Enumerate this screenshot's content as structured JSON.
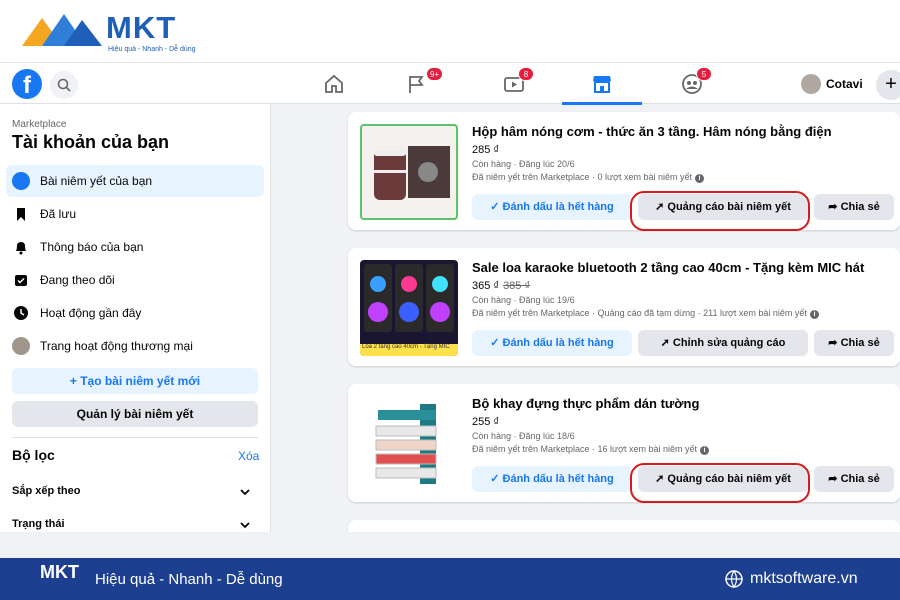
{
  "brand": {
    "name": "MKT",
    "tagline": "Hiệu quả - Nhanh - Dễ dùng"
  },
  "nav": {
    "logo_letter": "f",
    "badges": {
      "flag": "9+",
      "video": "8",
      "groups": "5"
    },
    "user_name": "Cotavi",
    "plus_label": "+"
  },
  "sidebar": {
    "section": "Marketplace",
    "title": "Tài khoản của bạn",
    "items": [
      {
        "label": "Bài niêm yết của bạn",
        "icon": "tag-icon"
      },
      {
        "label": "Đã lưu",
        "icon": "bookmark-icon"
      },
      {
        "label": "Thông báo của bạn",
        "icon": "bell-icon"
      },
      {
        "label": "Đang theo dõi",
        "icon": "following-icon"
      },
      {
        "label": "Hoạt động gần đây",
        "icon": "clock-icon"
      },
      {
        "label": "Trang hoạt động thương mại",
        "icon": "avatar"
      }
    ],
    "create_button": "+ Tạo bài niêm yết mới",
    "manage_button": "Quản lý bài niêm yết",
    "filter_title": "Bộ lọc",
    "filter_clear": "Xóa",
    "sort_label": "Sắp xếp theo",
    "status_label": "Trạng thái"
  },
  "listings": [
    {
      "title": "Hộp hâm nóng cơm - thức ăn 3 tầng. Hâm nóng bằng điện",
      "price": "285 ₫",
      "old_price": "",
      "meta": "Còn hàng · Đăng lúc 20/6",
      "stats": "Đã niêm yết trên Marketplace · 0 lượt xem bài niêm yết",
      "mark_button": "Đánh dấu là hết hàng",
      "ad_button": "Quảng cáo bài niêm yết",
      "share_button": "Chia sẻ"
    },
    {
      "title": "Sale loa karaoke bluetooth 2 tầng cao 40cm - Tặng kèm MIC hát",
      "price": "365 ₫",
      "old_price": "385 ₫",
      "meta": "Còn hàng · Đăng lúc 19/6",
      "stats": "Đã niêm yết trên Marketplace · Quảng cáo đã tạm dừng · 211 lượt xem bài niêm yết",
      "thumb_caption": "Loa 2 tầng cao 40cm - Tặng MIC",
      "mark_button": "Đánh dấu là hết hàng",
      "ad_button": "Chỉnh sửa quảng cáo",
      "share_button": "Chia sẻ"
    },
    {
      "title": "Bộ khay đựng thực phẩm dán tường",
      "price": "255 ₫",
      "old_price": "",
      "meta": "Còn hàng · Đăng lúc 18/6",
      "stats": "Đã niêm yết trên Marketplace · 16 lượt xem bài niêm yết",
      "mark_button": "Đánh dấu là hết hàng",
      "ad_button": "Quảng cáo bài niêm yết",
      "share_button": "Chia sẻ"
    }
  ],
  "footer": {
    "logo": "MKT",
    "slogan": "Hiệu quả - Nhanh - Dễ dùng",
    "site": "mktsoftware.vn"
  },
  "colors": {
    "accent": "#1877f2",
    "highlight": "#d71a1a",
    "footer": "#1c3f8f"
  }
}
